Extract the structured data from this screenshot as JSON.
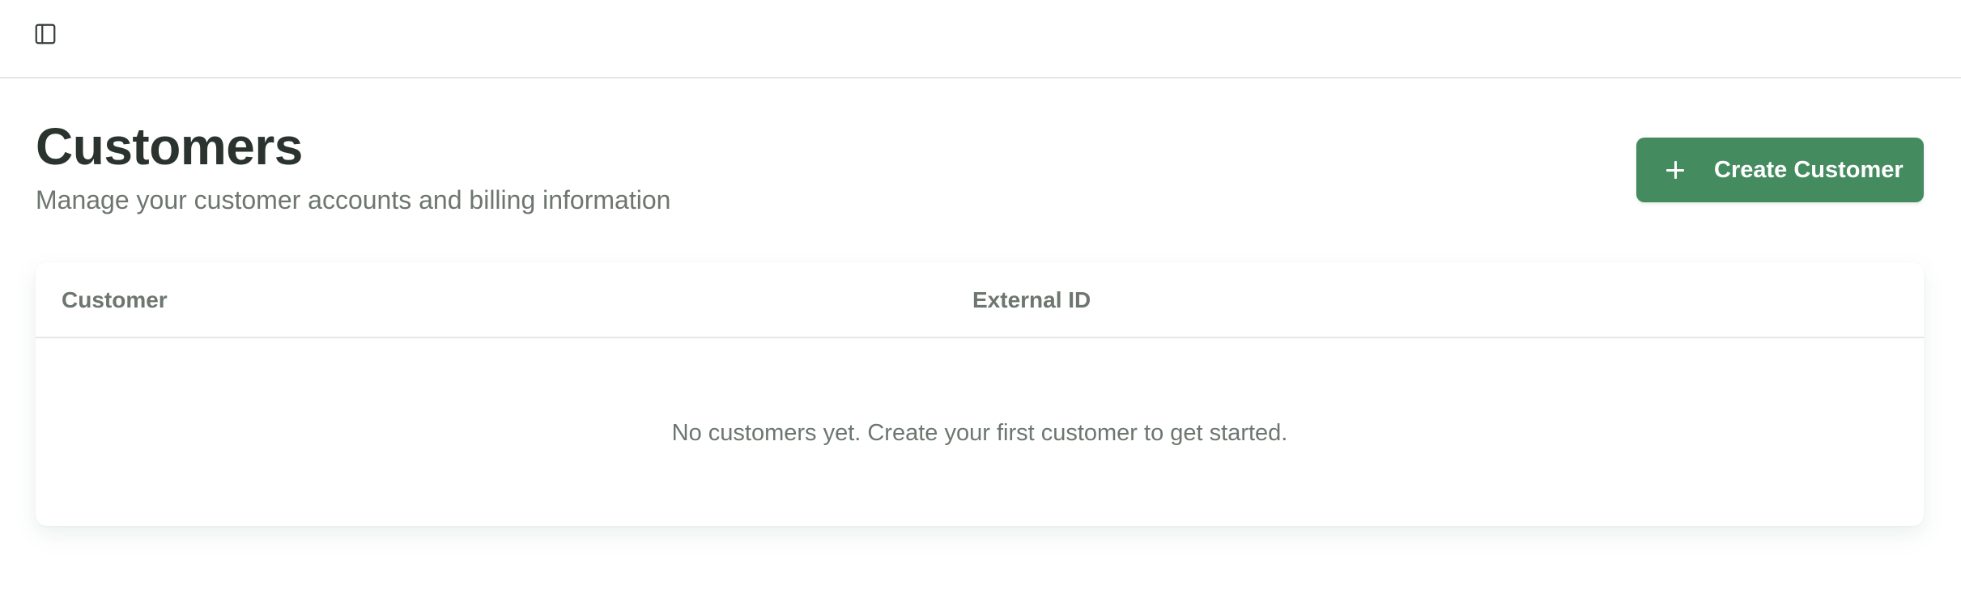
{
  "topbar": {
    "toggle_icon": "sidebar-toggle-icon"
  },
  "header": {
    "title": "Customers",
    "subtitle": "Manage your customer accounts and billing information"
  },
  "actions": {
    "create_label": "Create Customer",
    "create_icon": "plus-icon"
  },
  "table": {
    "columns": [
      "Customer",
      "External ID"
    ],
    "empty_message": "No customers yet. Create your first customer to get started."
  },
  "colors": {
    "accent": "#458b60",
    "title": "#2b332e",
    "muted": "#6d766f",
    "border": "#e3e6e4"
  }
}
